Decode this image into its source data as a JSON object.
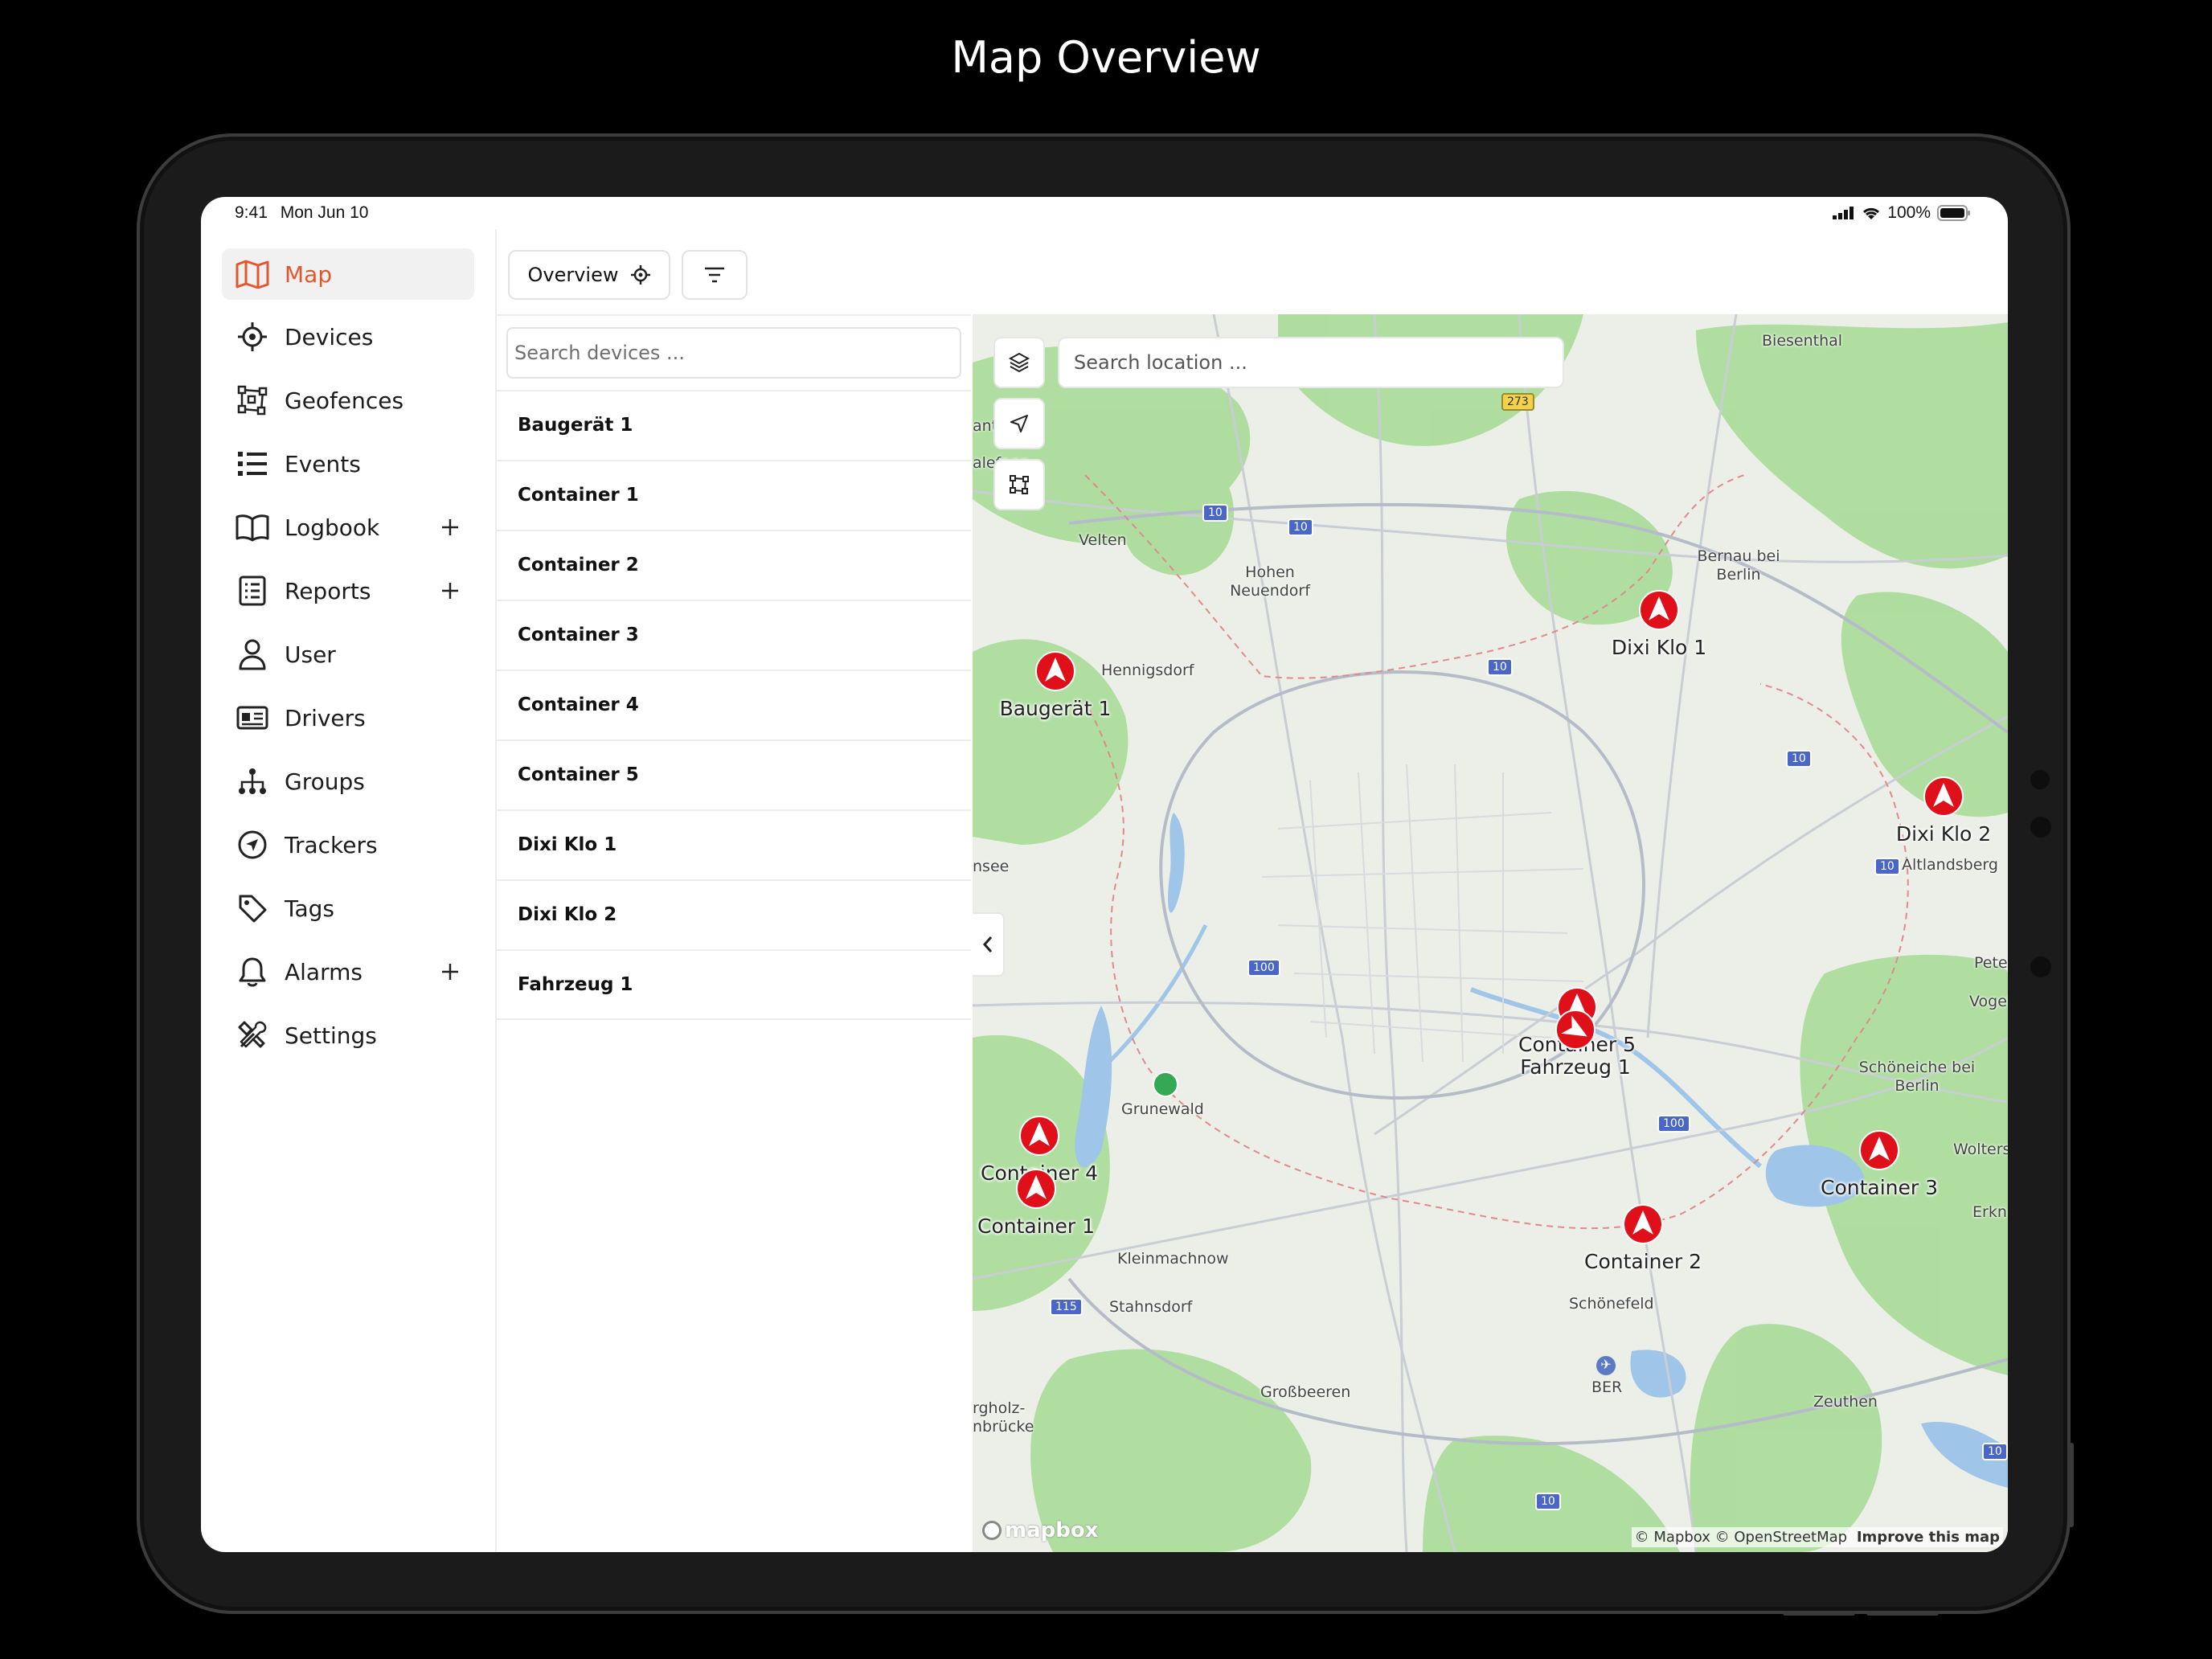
{
  "page_title": "Map Overview",
  "status_bar": {
    "time": "9:41",
    "date": "Mon Jun 10",
    "battery": "100%"
  },
  "colors": {
    "accent": "#e4572e",
    "marker_red": "#e0101a"
  },
  "sidebar": {
    "items": [
      {
        "label": "Map",
        "icon": "map-icon",
        "active": true
      },
      {
        "label": "Devices",
        "icon": "target-icon"
      },
      {
        "label": "Geofences",
        "icon": "geofence-icon"
      },
      {
        "label": "Events",
        "icon": "list-icon"
      },
      {
        "label": "Logbook",
        "icon": "book-icon",
        "expandable": true
      },
      {
        "label": "Reports",
        "icon": "report-icon",
        "expandable": true
      },
      {
        "label": "User",
        "icon": "user-icon"
      },
      {
        "label": "Drivers",
        "icon": "id-card-icon"
      },
      {
        "label": "Groups",
        "icon": "hierarchy-icon"
      },
      {
        "label": "Trackers",
        "icon": "compass-icon"
      },
      {
        "label": "Tags",
        "icon": "tag-icon"
      },
      {
        "label": "Alarms",
        "icon": "bell-icon",
        "expandable": true
      },
      {
        "label": "Settings",
        "icon": "tools-icon"
      }
    ]
  },
  "toolbar": {
    "overview_label": "Overview",
    "filter_icon": "filter-icon"
  },
  "device_list": {
    "search_placeholder": "Search devices ...",
    "items": [
      "Baugerät 1",
      "Container 1",
      "Container 2",
      "Container 3",
      "Container 4",
      "Container 5",
      "Dixi Klo 1",
      "Dixi Klo 2",
      "Fahrzeug 1"
    ]
  },
  "map": {
    "search_placeholder": "Search location ...",
    "markers": [
      "Baugerät 1",
      "Dixi Klo 1",
      "Dixi Klo 2",
      "Container 5",
      "Fahrzeug 1",
      "Container 4",
      "Container 1",
      "Container 3",
      "Container 2"
    ],
    "places": [
      "Biesenthal",
      "Velten",
      "Hohen Neuendorf",
      "Bernau bei Berlin",
      "Hennigsdorf",
      "Altlandsberg",
      "Grunewald",
      "Schöneiche bei Berlin",
      "Kleinmachnow",
      "Stahnsdorf",
      "Schönefeld",
      "BER",
      "Großbeeren",
      "Zeuthen",
      "Peter",
      "Vogel",
      "Wolters",
      "Erkn",
      "nsee",
      "ante",
      "alefanz",
      "rgholz-nbrücke"
    ],
    "road_shields": [
      "273",
      "10",
      "10",
      "10",
      "10",
      "10",
      "100",
      "100",
      "115",
      "10",
      "10"
    ],
    "logo": "mapbox",
    "attribution": "© Mapbox © OpenStreetMap",
    "improve": "Improve this map"
  }
}
